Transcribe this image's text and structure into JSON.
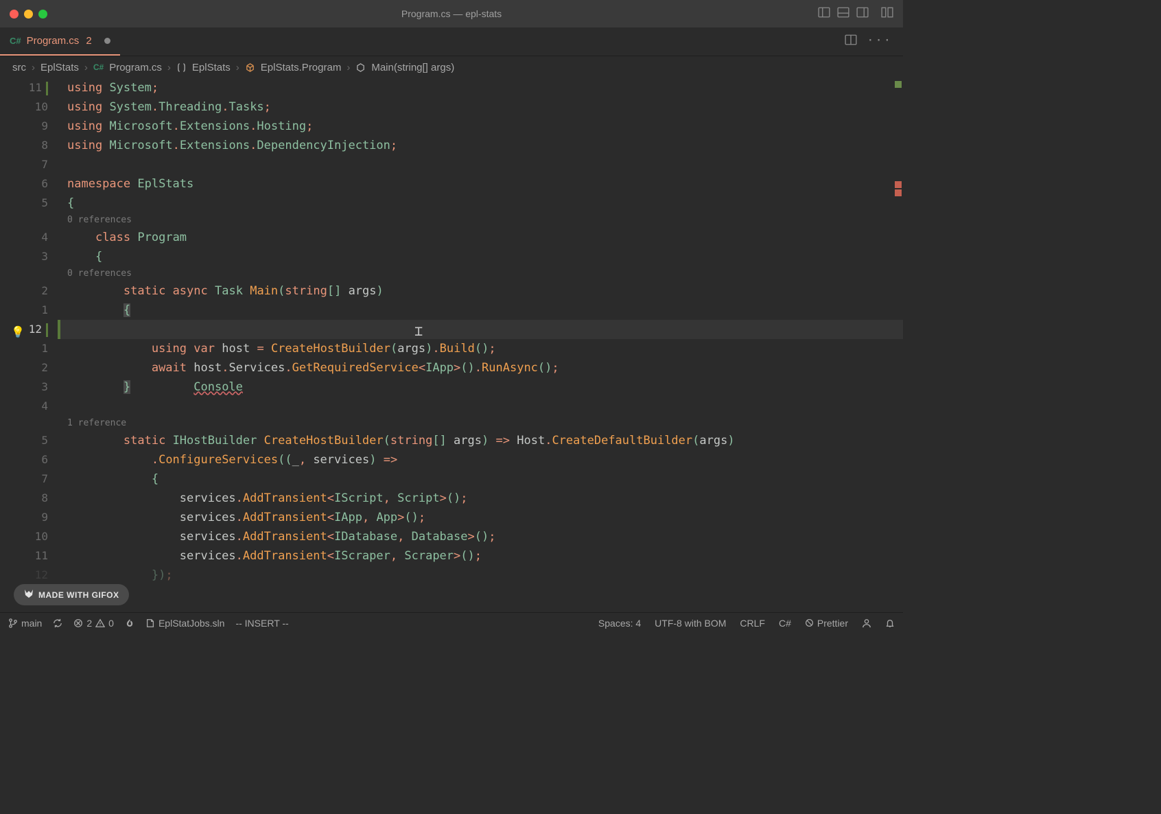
{
  "window": {
    "title": "Program.cs — epl-stats"
  },
  "tab": {
    "icon": "C#",
    "name": "Program.cs",
    "problems": "2"
  },
  "breadcrumb": {
    "p0": "src",
    "p1": "EplStats",
    "p2": "Program.cs",
    "p3": "EplStats",
    "p4": "EplStats.Program",
    "p5": "Main(string[] args)"
  },
  "gutter": [
    "11",
    "10",
    "9",
    "8",
    "7",
    "6",
    "5",
    "",
    "4",
    "3",
    "",
    "2",
    "1",
    "12",
    "1",
    "2",
    "3",
    "4",
    "",
    "5",
    "6",
    "7",
    "8",
    "9",
    "10",
    "11",
    "",
    "12"
  ],
  "codelens": {
    "r0": "0 references",
    "r1": "0 references",
    "r2": "1 reference"
  },
  "tokens": {
    "using": "using",
    "namespace": "namespace",
    "class": "class",
    "static": "static",
    "async": "async",
    "await": "await",
    "var": "var",
    "system": "System",
    "threading": "Threading",
    "tasks": "Tasks",
    "microsoft": "Microsoft",
    "extensions": "Extensions",
    "hosting": "Hosting",
    "di": "DependencyInjection",
    "eplstats": "EplStats",
    "program": "Program",
    "task": "Task",
    "main": "Main",
    "string": "string",
    "args": "args",
    "console": "Console",
    "host_l": "host",
    "chb": "CreateHostBuilder",
    "build": "Build",
    "services_prop": "Services",
    "grs": "GetRequiredService",
    "iapp": "IApp",
    "runasync": "RunAsync",
    "ihb": "IHostBuilder",
    "arrow": "=>",
    "host_ns": "Host",
    "cdb": "CreateDefaultBuilder",
    "cfg": "ConfigureServices",
    "underscore": "_",
    "services": "services",
    "addt": "AddTransient",
    "iscript": "IScript",
    "script": "Script",
    "app": "App",
    "idatabase": "IDatabase",
    "database": "Database",
    "iscraper": "IScraper",
    "scraper": "Scraper"
  },
  "status": {
    "branch": "main",
    "errors": "2",
    "warnings": "0",
    "file": "EplStatJobs.sln",
    "mode": "-- INSERT --",
    "spaces": "Spaces: 4",
    "encoding": "UTF-8 with BOM",
    "eol": "CRLF",
    "lang": "C#",
    "prettier": "Prettier"
  },
  "badge": {
    "text": "MADE WITH GIFOX"
  }
}
